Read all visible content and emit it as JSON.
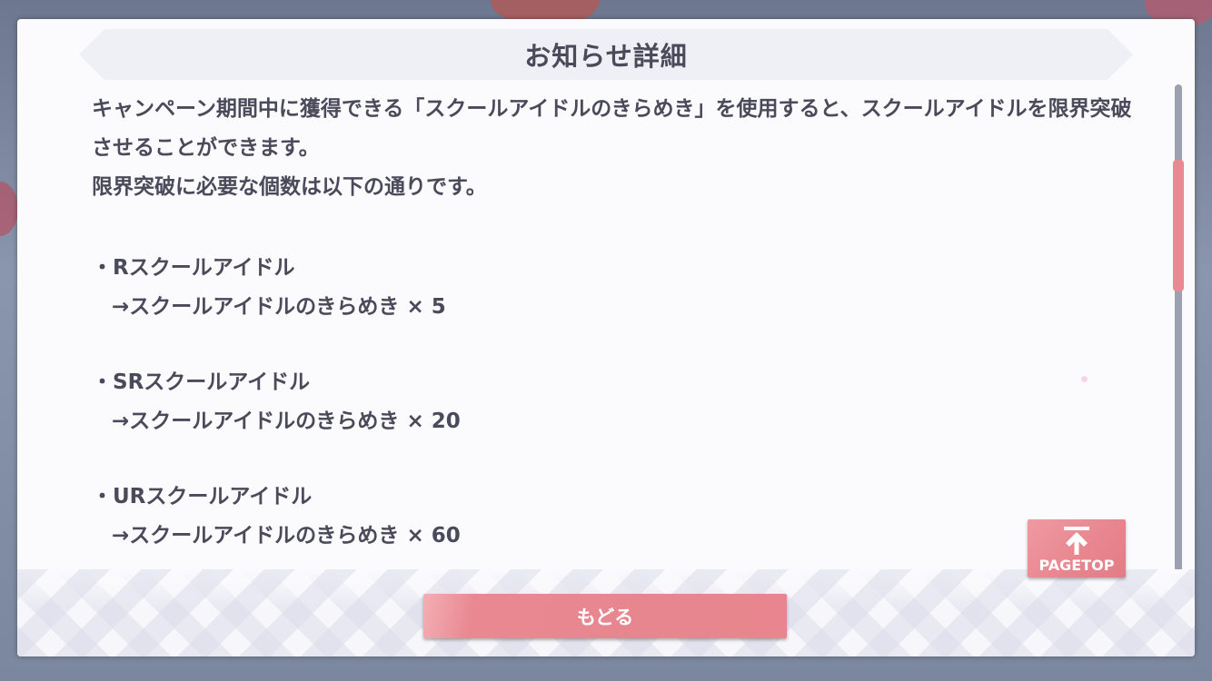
{
  "dialog": {
    "title": "お知らせ詳細",
    "paragraphs": [
      "キャンペーン期間中に獲得できる「スクールアイドルのきらめき」を使用すると、スクールアイドルを限界突破させることができます。",
      "限界突破に必要な個数は以下の通りです。"
    ],
    "items": [
      {
        "name": "・Rスクールアイドル",
        "cost": "→スクールアイドルのきらめき × 5"
      },
      {
        "name": "・SRスクールアイドル",
        "cost": "→スクールアイドルのきらめき × 20"
      },
      {
        "name": "・URスクールアイドル",
        "cost": "→スクールアイドルのきらめき × 60"
      }
    ],
    "pagetop_label": "PAGETOP",
    "back_label": "もどる",
    "icons": {
      "pagetop": "arrow-up-to-top-icon"
    },
    "colors": {
      "accent": "#e8858e",
      "text": "#4a4a5a",
      "panel": "#fbfbfe"
    }
  }
}
